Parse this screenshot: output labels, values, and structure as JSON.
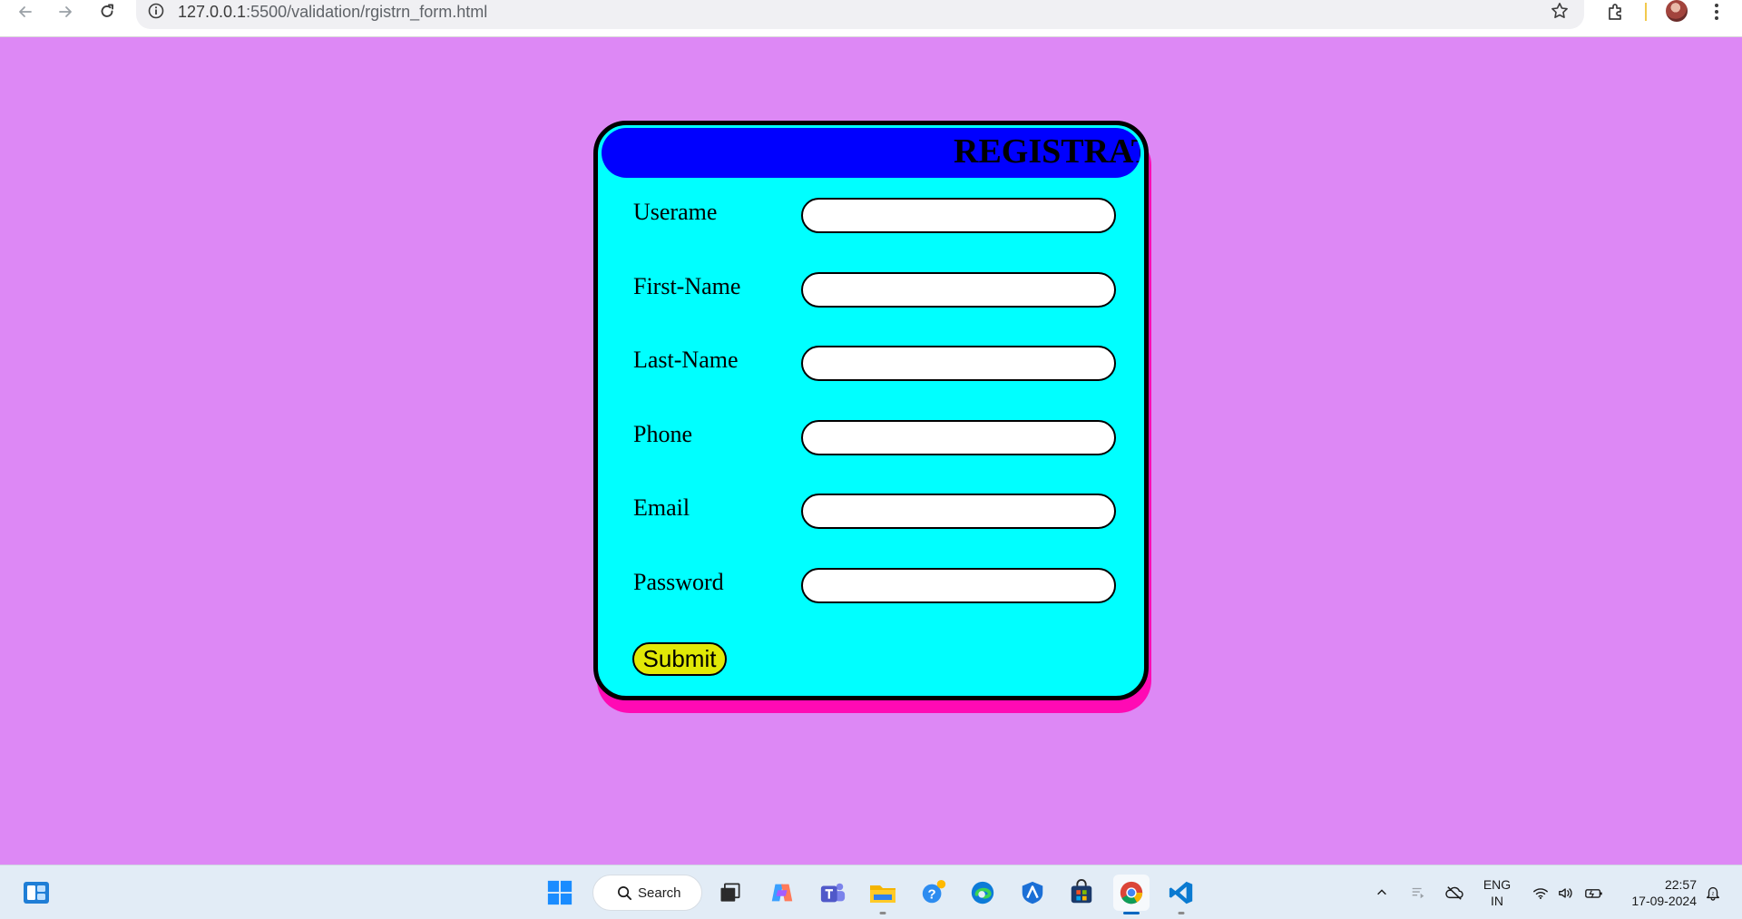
{
  "browser": {
    "url_host": "127.0.0.1",
    "url_path": ":5500/validation/rgistrn_form.html"
  },
  "form": {
    "title": "REGISTRATION",
    "fields": [
      {
        "label": "Userame",
        "value": ""
      },
      {
        "label": "First-Name",
        "value": ""
      },
      {
        "label": "Last-Name",
        "value": ""
      },
      {
        "label": "Phone",
        "value": ""
      },
      {
        "label": "Email",
        "value": ""
      },
      {
        "label": "Password",
        "value": ""
      }
    ],
    "submit_label": "Submit"
  },
  "taskbar": {
    "search_label": "Search",
    "language": "ENG",
    "region": "IN",
    "time": "22:57",
    "date": "17-09-2024"
  },
  "colors": {
    "page_background": "#dd88f5",
    "card_background": "#00ffff",
    "card_shadow": "#ff0ab4",
    "header_background": "#0000ff",
    "submit_background": "#e1e806"
  }
}
